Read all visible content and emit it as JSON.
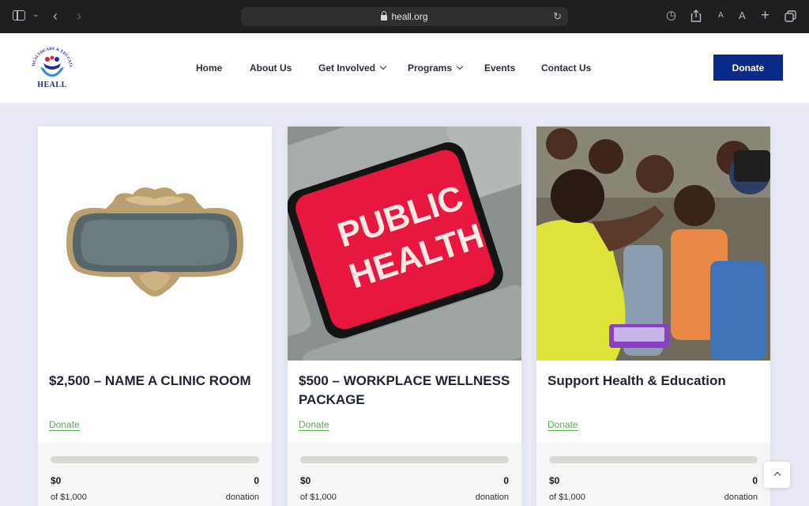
{
  "browser": {
    "url": "heall.org",
    "icons": [
      "sidebar-icon",
      "chevron-down-icon",
      "back-icon",
      "forward-icon",
      "lock-icon",
      "reload-icon",
      "history-icon",
      "share-icon",
      "text-smaller-icon",
      "text-larger-icon",
      "new-tab-icon",
      "tabs-overview-icon"
    ],
    "text_size_small": "A",
    "text_size_large": "A"
  },
  "site": {
    "logo_text": "HEALL",
    "logo_ring_text": "HEALTHCARE & EDUCATION FOR ALL",
    "brand_color": "#0a2a8a",
    "accent_color": "#5cab55"
  },
  "nav": {
    "items": [
      {
        "label": "Home"
      },
      {
        "label": "About Us"
      },
      {
        "label": "Get Involved",
        "has_dropdown": true
      },
      {
        "label": "Programs",
        "has_dropdown": true
      },
      {
        "label": "Events"
      },
      {
        "label": "Contact Us"
      }
    ],
    "donate_label": "Donate"
  },
  "cards": [
    {
      "title": "$2,500 – NAME A CLINIC ROOM",
      "link_label": "Donate",
      "raised": "$0",
      "goal": "of $1,000",
      "donations": "0",
      "donations_label": "donation",
      "progress": 0,
      "image": "bronze name plaque"
    },
    {
      "title": "$500 – WORKPLACE WELLNESS PACKAGE",
      "link_label": "Donate",
      "raised": "$0",
      "goal": "of $1,000",
      "donations": "0",
      "donations_label": "donation",
      "progress": 0,
      "image": "red keyboard key",
      "image_text_line1": "PUBLIC",
      "image_text_line2": "HEALTH"
    },
    {
      "title": "Support Health & Education",
      "link_label": "Donate",
      "raised": "$0",
      "goal": "of $1,000",
      "donations": "0",
      "donations_label": "donation",
      "progress": 0,
      "image": "volunteer with children"
    }
  ]
}
